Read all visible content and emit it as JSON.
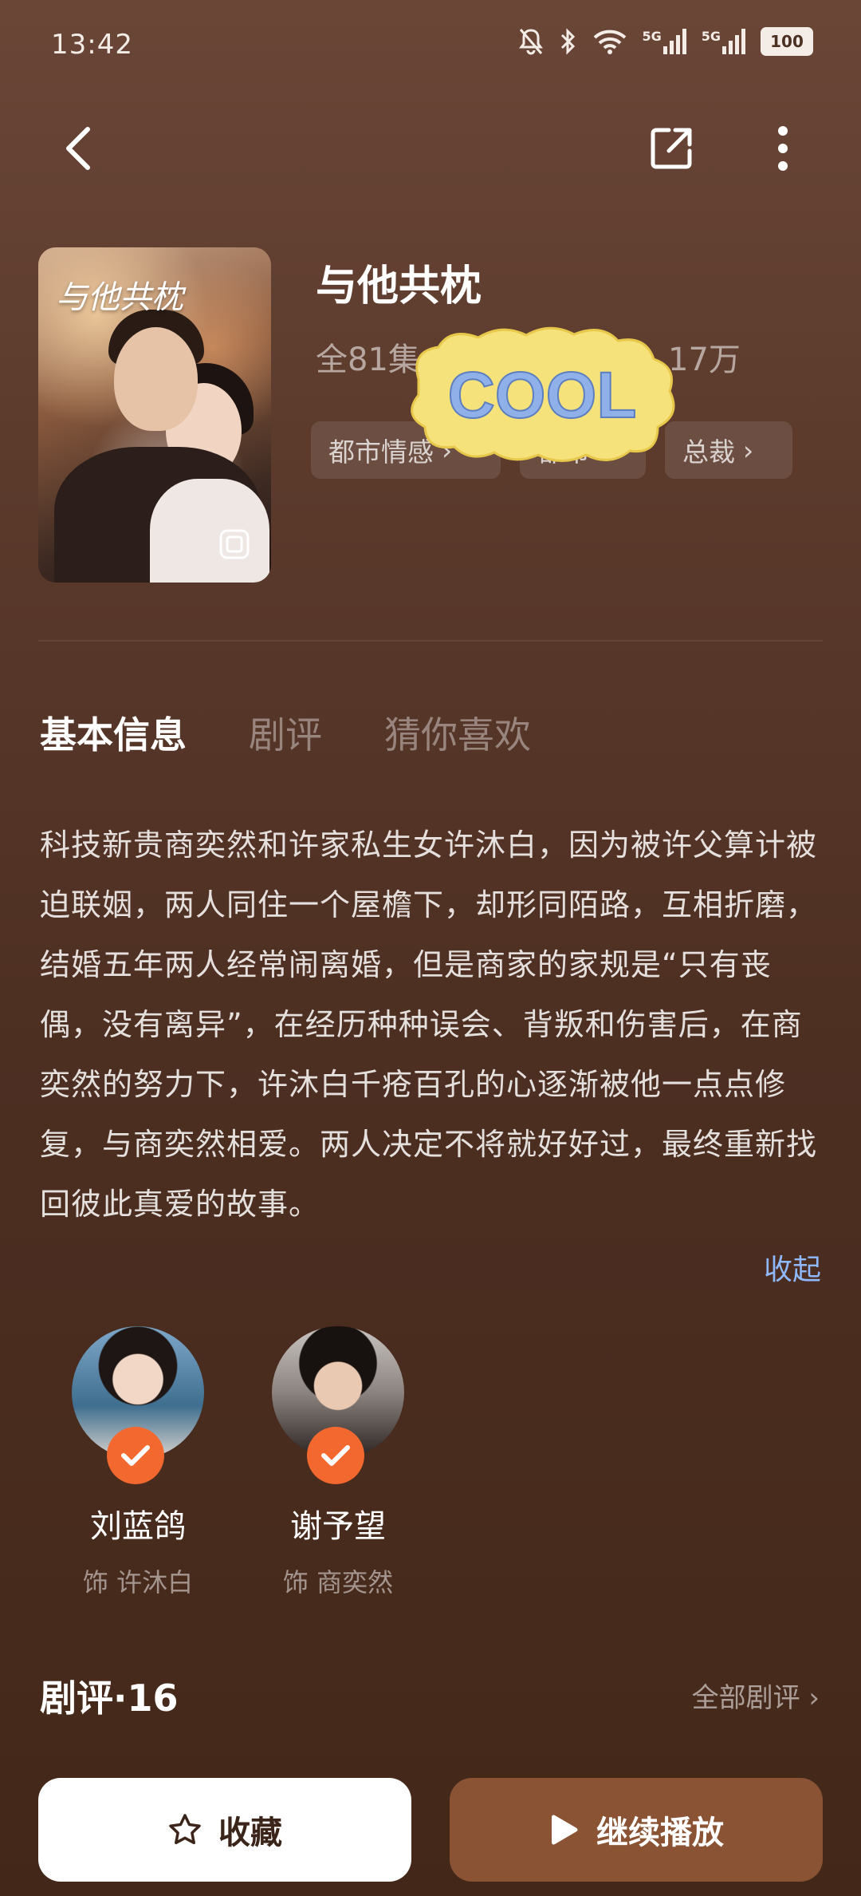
{
  "status_bar": {
    "time": "13:42",
    "network_1": "5G",
    "network_2": "5G",
    "battery": "100",
    "icons": [
      "mute-icon",
      "bluetooth-icon",
      "wifi-icon",
      "signal-icon",
      "signal-icon",
      "battery-icon"
    ]
  },
  "header": {
    "icons": [
      "back-icon",
      "share-icon",
      "more-icon"
    ]
  },
  "drama": {
    "poster_title": "与他共枕",
    "title": "与他共枕",
    "episodes": "全81集",
    "views": "17万",
    "genres": [
      "都市情感",
      "都市",
      "总裁"
    ],
    "sticker": "COOL"
  },
  "tabs": [
    "基本信息",
    "剧评",
    "猜你喜欢"
  ],
  "synopsis": {
    "text": "科技新贵商奕然和许家私生女许沐白，因为被许父算计被迫联姻，两人同住一个屋檐下，却形同陌路，互相折磨，结婚五年两人经常闹离婚，但是商家的家规是“只有丧偶，没有离异”，在经历种种误会、背叛和伤害后，在商奕然的努力下，许沐白千疮百孔的心逐渐被他一点点修复，与商奕然相爱。两人决定不将就好好过，最终重新找回彼此真爱的故事。",
    "collapse": "收起"
  },
  "cast": [
    {
      "name": "刘蓝鸽",
      "role": "饰 许沐白"
    },
    {
      "name": "谢予望",
      "role": "饰 商奕然"
    }
  ],
  "reviews": {
    "title": "剧评·16",
    "all": "全部剧评"
  },
  "actions": {
    "favorite": "收藏",
    "play": "继续播放"
  },
  "colors": {
    "accent": "#f2682f",
    "play_button": "#8a5334",
    "link": "#8fb8ff"
  }
}
